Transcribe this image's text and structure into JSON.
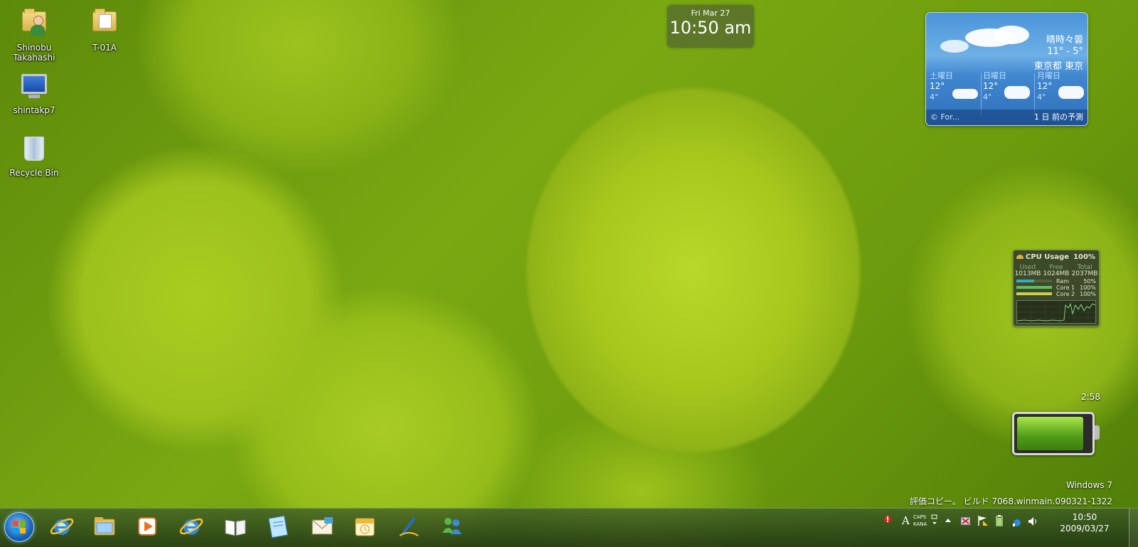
{
  "desktop_icons": [
    {
      "label": "Shinobu Takahashi",
      "icon": "user-folder-icon"
    },
    {
      "label": "T-01A",
      "icon": "folder-icon"
    },
    {
      "label": "shintakp7",
      "icon": "computer-icon"
    },
    {
      "label": "Recycle Bin",
      "icon": "recycle-bin-icon"
    }
  ],
  "clock_gadget": {
    "date": "Fri Mar 27",
    "time": "10:50 am"
  },
  "weather_gadget": {
    "condition": "晴時々曇",
    "temp_range": "11° - 5°",
    "location": "東京都 東京",
    "forecast": [
      {
        "day": "土曜日",
        "high": "12°",
        "low": "4°"
      },
      {
        "day": "日曜日",
        "high": "12°",
        "low": "4°"
      },
      {
        "day": "月曜日",
        "high": "12°",
        "low": "4°"
      }
    ],
    "source": "© For...",
    "updated": "1 日 前の予測"
  },
  "cpu_gadget": {
    "title": "CPU Usage",
    "percent": "100%",
    "headers": [
      "Used",
      "Free",
      "Total"
    ],
    "values": [
      "1013MB",
      "1024MB",
      "2037MB"
    ],
    "rows": [
      {
        "label": "Ram",
        "value": "50%",
        "level": 0.5,
        "color": "#3fa7b8"
      },
      {
        "label": "Core 1",
        "value": "100%",
        "level": 1.0,
        "color": "#5ac15a"
      },
      {
        "label": "Core 2",
        "value": "100%",
        "level": 1.0,
        "color": "#d0cf4c"
      }
    ]
  },
  "battery_gadget": {
    "time_remaining": "2:58",
    "level": 0.92
  },
  "watermark": {
    "line1": "Windows 7",
    "line2": "評価コピー。 ビルド 7068.winmain.090321-1322"
  },
  "taskbar": {
    "pinned": [
      {
        "name": "internet-explorer-icon"
      },
      {
        "name": "windows-explorer-icon"
      },
      {
        "name": "media-player-icon"
      },
      {
        "name": "internet-explorer-icon"
      },
      {
        "name": "reader-book-icon"
      },
      {
        "name": "notepad-icon"
      },
      {
        "name": "mail-icon"
      },
      {
        "name": "calendar-icon"
      },
      {
        "name": "pen-icon"
      },
      {
        "name": "messenger-icon"
      }
    ],
    "ime_mode": "A",
    "caps": "CAPS",
    "kana": "KANA",
    "clock_time": "10:50",
    "clock_date": "2009/03/27"
  }
}
